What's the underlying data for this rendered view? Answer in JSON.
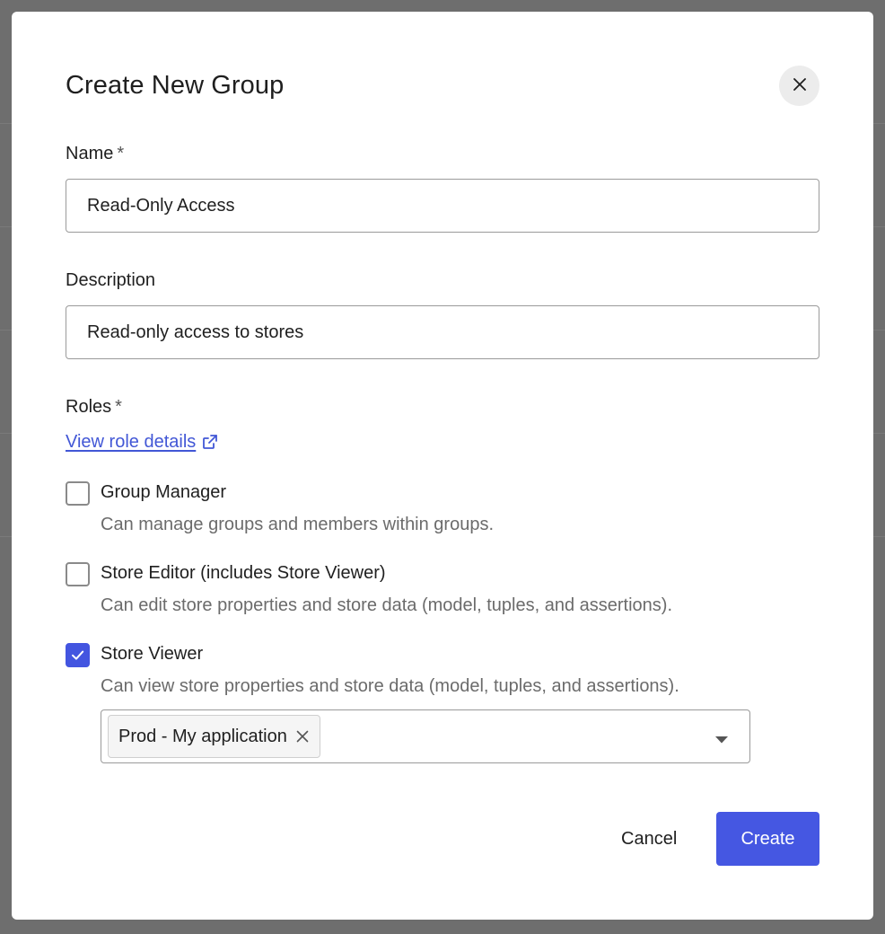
{
  "dialog": {
    "title": "Create New Group",
    "close_label": "Close"
  },
  "form": {
    "name": {
      "label": "Name",
      "required_mark": "*",
      "value": "Read-Only Access"
    },
    "description": {
      "label": "Description",
      "value": "Read-only access to stores"
    },
    "roles": {
      "label": "Roles",
      "required_mark": "*",
      "details_link": "View role details",
      "items": [
        {
          "title": "Group Manager",
          "description": "Can manage groups and members within groups.",
          "checked": false
        },
        {
          "title": "Store Editor (includes Store Viewer)",
          "description": "Can edit store properties and store data (model, tuples, and assertions).",
          "checked": false
        },
        {
          "title": "Store Viewer",
          "description": "Can view store properties and store data (model, tuples, and assertions).",
          "checked": true
        }
      ],
      "store_select": {
        "selected": [
          "Prod - My application"
        ]
      }
    }
  },
  "actions": {
    "cancel_label": "Cancel",
    "create_label": "Create"
  },
  "colors": {
    "accent": "#4557e2",
    "link": "#4257d6",
    "overlay": "#6e6e6e"
  }
}
